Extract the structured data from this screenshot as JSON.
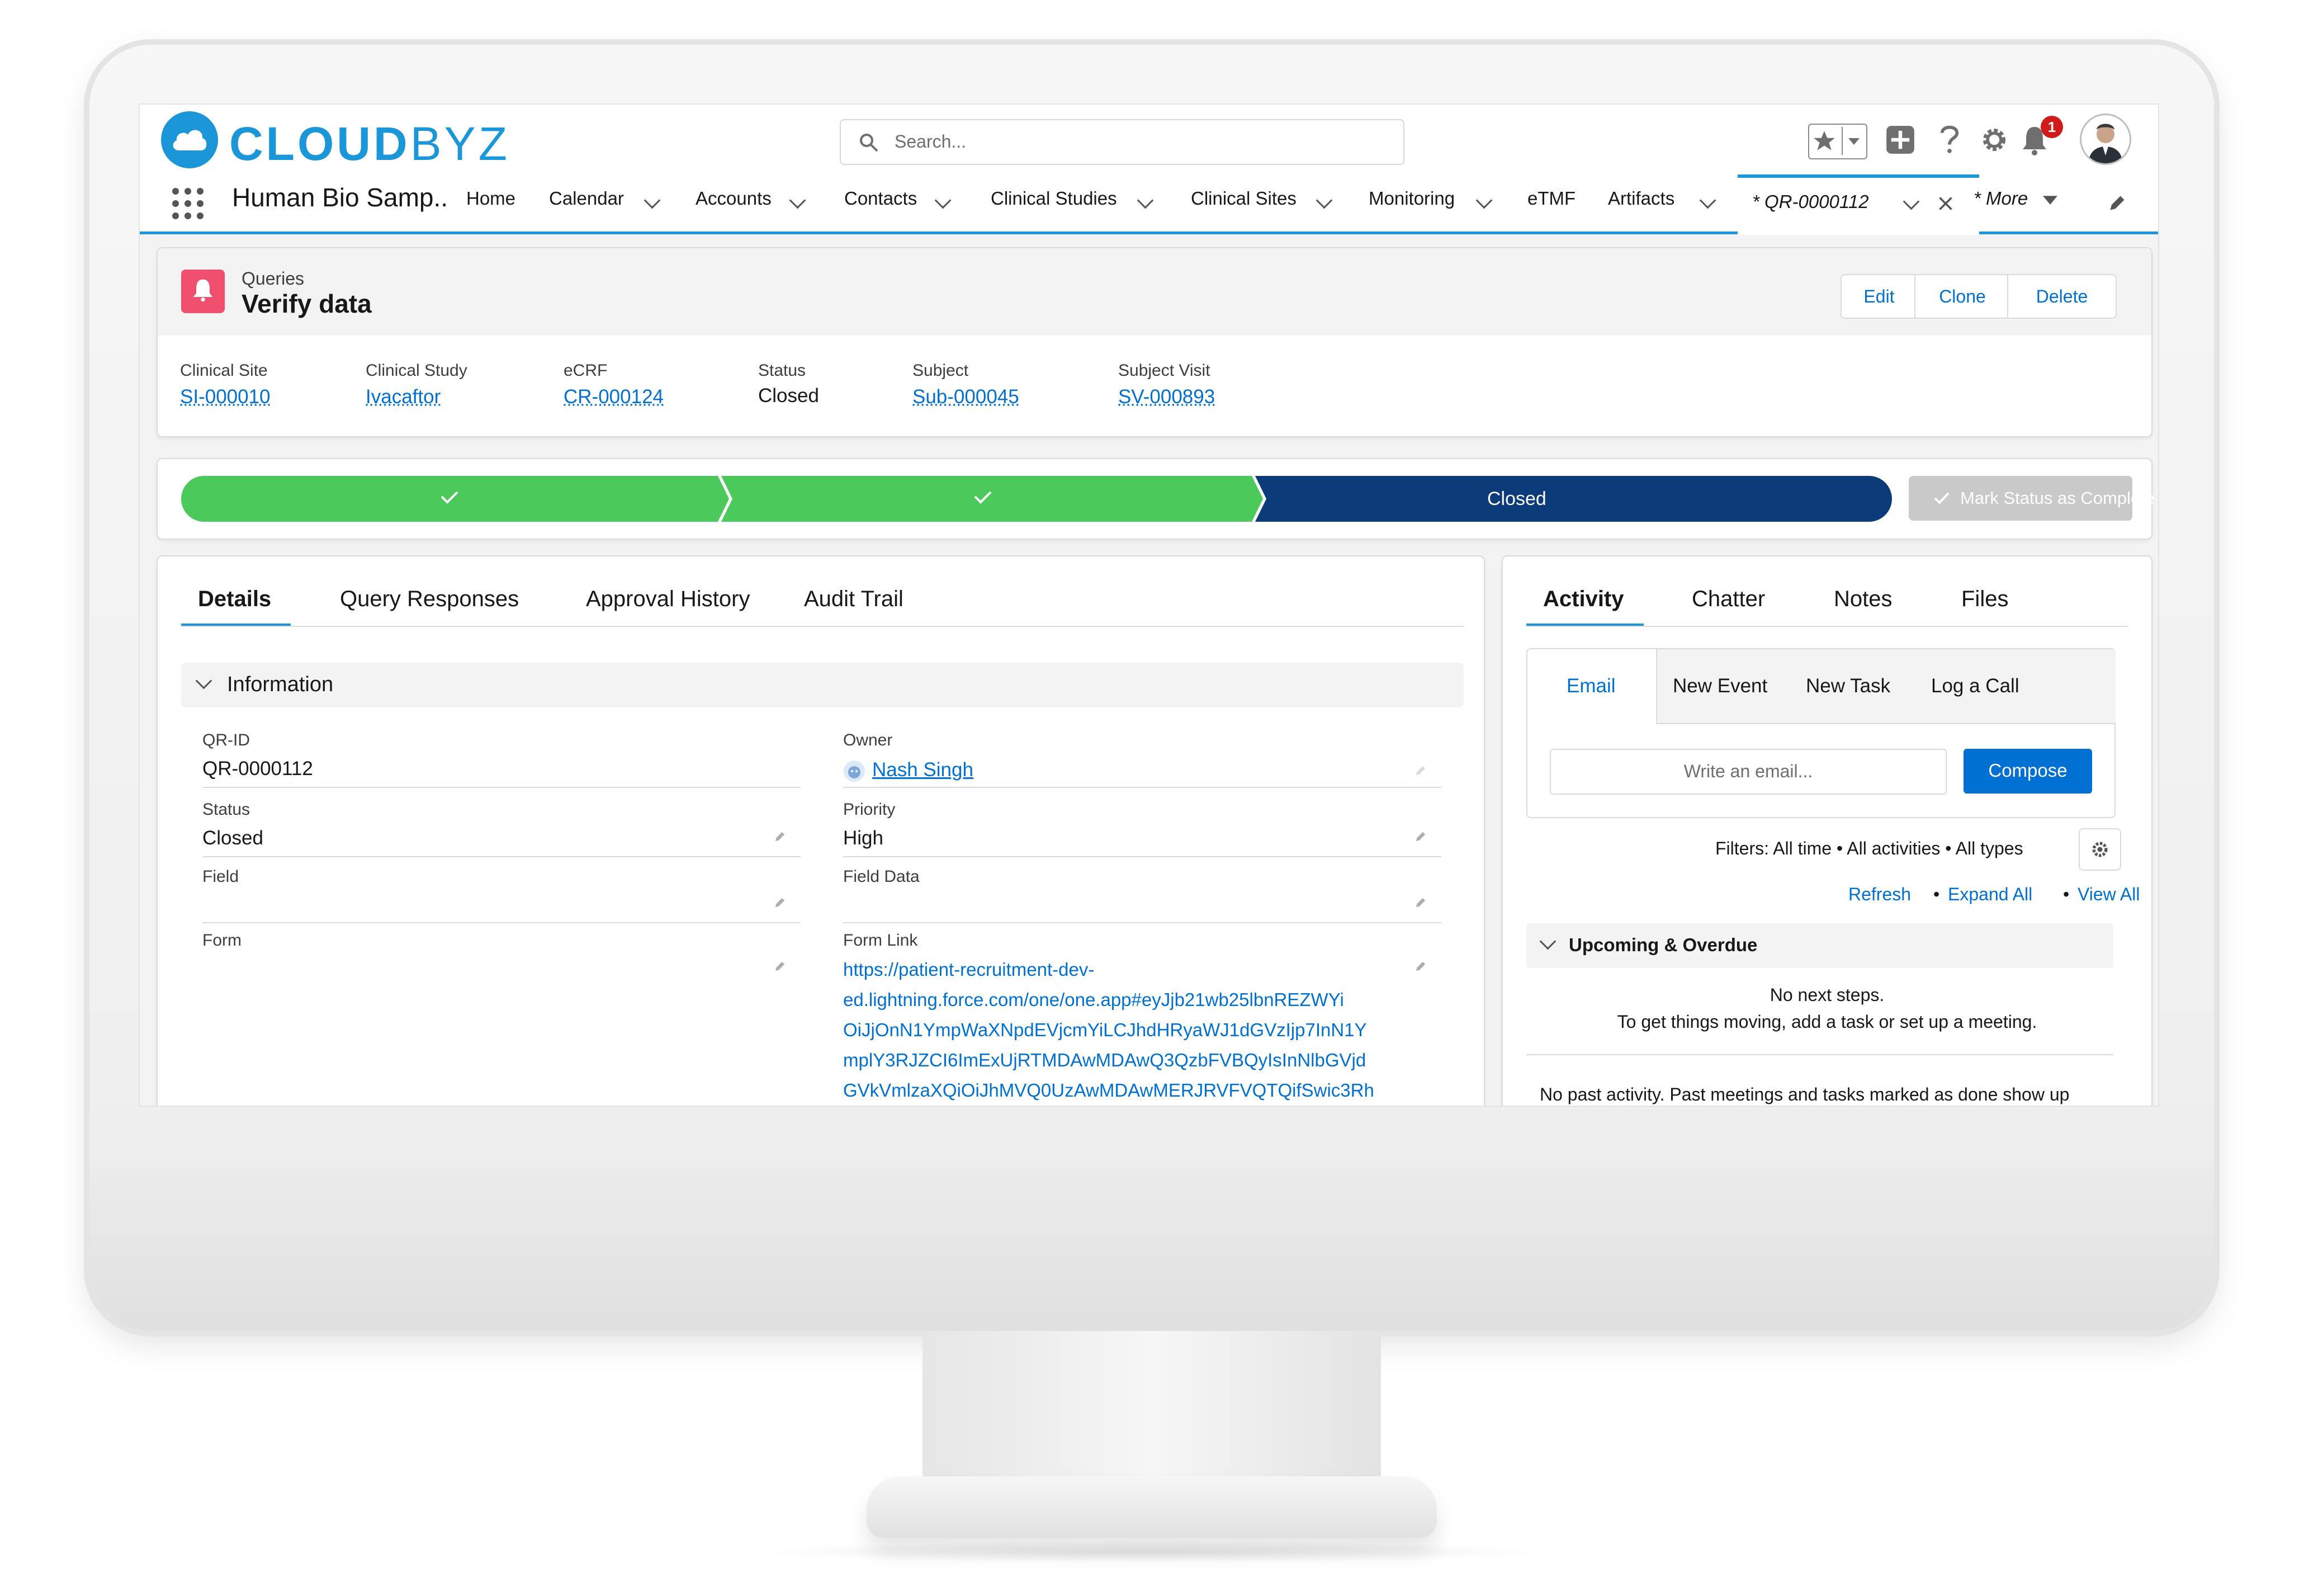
{
  "header": {
    "logo": {
      "bold": "CLOUD",
      "light": "BYZ"
    },
    "search_placeholder": "Search...",
    "notification_count": "1",
    "icons": [
      "favorites-star-icon",
      "add-icon",
      "help-icon",
      "setup-gear-icon",
      "notification-bell-icon",
      "user-avatar"
    ]
  },
  "nav": {
    "app_name": "Human Bio Samp..",
    "items": [
      "Home",
      "Calendar",
      "Accounts",
      "Contacts",
      "Clinical Studies",
      "Clinical Sites",
      "Monitoring",
      "eTMF",
      "Artifacts"
    ],
    "active_tab": "* QR-0000112",
    "more": "* More"
  },
  "record": {
    "object": "Queries",
    "title": "Verify data",
    "actions": [
      "Edit",
      "Clone",
      "Delete"
    ],
    "highlights": [
      {
        "label": "Clinical Site",
        "value": "SI-000010",
        "link": true
      },
      {
        "label": "Clinical Study",
        "value": "Ivacaftor",
        "link": true
      },
      {
        "label": "eCRF",
        "value": "CR-000124",
        "link": true
      },
      {
        "label": "Status",
        "value": "Closed",
        "link": false
      },
      {
        "label": "Subject",
        "value": "Sub-000045",
        "link": true
      },
      {
        "label": "Subject Visit",
        "value": "SV-000893",
        "link": true
      }
    ]
  },
  "path": {
    "current_stage": "Closed",
    "completed_marks": [
      "✓",
      "✓"
    ],
    "mark_complete_button": "Mark Status as Complete"
  },
  "details": {
    "tabs": [
      "Details",
      "Query Responses",
      "Approval History",
      "Audit Trail"
    ],
    "section_title": "Information",
    "left_fields": [
      {
        "label": "QR-ID",
        "value": "QR-0000112"
      },
      {
        "label": "Status",
        "value": "Closed"
      },
      {
        "label": "Field",
        "value": ""
      },
      {
        "label": "Form",
        "value": ""
      }
    ],
    "right_fields": [
      {
        "label": "Owner",
        "value": "Nash Singh"
      },
      {
        "label": "Priority",
        "value": "High"
      },
      {
        "label": "Field Data",
        "value": ""
      },
      {
        "label": "Form Link",
        "value": ""
      }
    ],
    "form_link_lines": [
      "https://patient-recruitment-dev-",
      "ed.lightning.force.com/one/one.app#eyJjb21wb25lbnREZWYi",
      "OiJjOnN1YmpWaXNpdEVjcmYiLCJhdHRyaWJ1dGVzIjp7InN1Y",
      "mplY3RJZCI6ImExUjRTMDAwMDAwQ3QzbFVBQyIsInNlbGVjd",
      "GVkVmlzaXQiOiJhMVQ0UzAwMDAwMERJRVFVQTQifSwic3Rh"
    ]
  },
  "activity": {
    "tabs": [
      "Activity",
      "Chatter",
      "Notes",
      "Files"
    ],
    "subtabs": [
      "Email",
      "New Event",
      "New Task",
      "Log a Call"
    ],
    "email_placeholder": "Write an email...",
    "compose": "Compose",
    "filters": "Filters: All time • All activities • All types",
    "links": [
      "Refresh",
      "Expand All",
      "View All"
    ],
    "upcoming_title": "Upcoming & Overdue",
    "no_steps": "No next steps.",
    "no_steps_hint": "To get things moving, add a task or set up a meeting.",
    "no_past": "No past activity. Past meetings and tasks marked as done show up"
  },
  "colors": {
    "brand_blue": "#1b96d8",
    "path_complete": "#4bca5b",
    "path_current": "#0b3b78",
    "link": "#0070d2",
    "query_icon": "#f0506e"
  }
}
